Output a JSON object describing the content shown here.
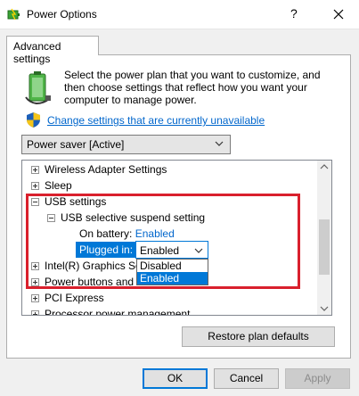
{
  "window": {
    "title": "Power Options",
    "help_label": "?"
  },
  "tab": {
    "label": "Advanced settings"
  },
  "intro": {
    "text": "Select the power plan that you want to customize, and then choose settings that reflect how you want your computer to manage power."
  },
  "change_link": {
    "label": "Change settings that are currently unavailable"
  },
  "plan_select": {
    "value": "Power saver [Active]"
  },
  "tree": {
    "wireless": "Wireless Adapter Settings",
    "sleep": "Sleep",
    "usb": "USB settings",
    "usb_suspend": "USB selective suspend setting",
    "on_battery_label": "On battery:",
    "on_battery_value": "Enabled",
    "plugged_in_label": "Plugged in:",
    "plugged_in_value": "Enabled",
    "intel": "Intel(R) Graphics Se",
    "power_buttons": "Power buttons and li",
    "pci": "PCI Express",
    "processor": "Processor power management"
  },
  "dropdown": {
    "options": [
      "Disabled",
      "Enabled"
    ],
    "selected": "Enabled"
  },
  "buttons": {
    "restore": "Restore plan defaults",
    "ok": "OK",
    "cancel": "Cancel",
    "apply": "Apply"
  },
  "colors": {
    "accent": "#0078d7",
    "link": "#0066cc",
    "highlight_box": "#d9202d"
  },
  "icons": [
    "power-options-icon",
    "battery-plan-icon",
    "uac-shield-icon",
    "chevron-down-icon",
    "scroll-up-icon",
    "scroll-down-icon",
    "close-icon"
  ]
}
